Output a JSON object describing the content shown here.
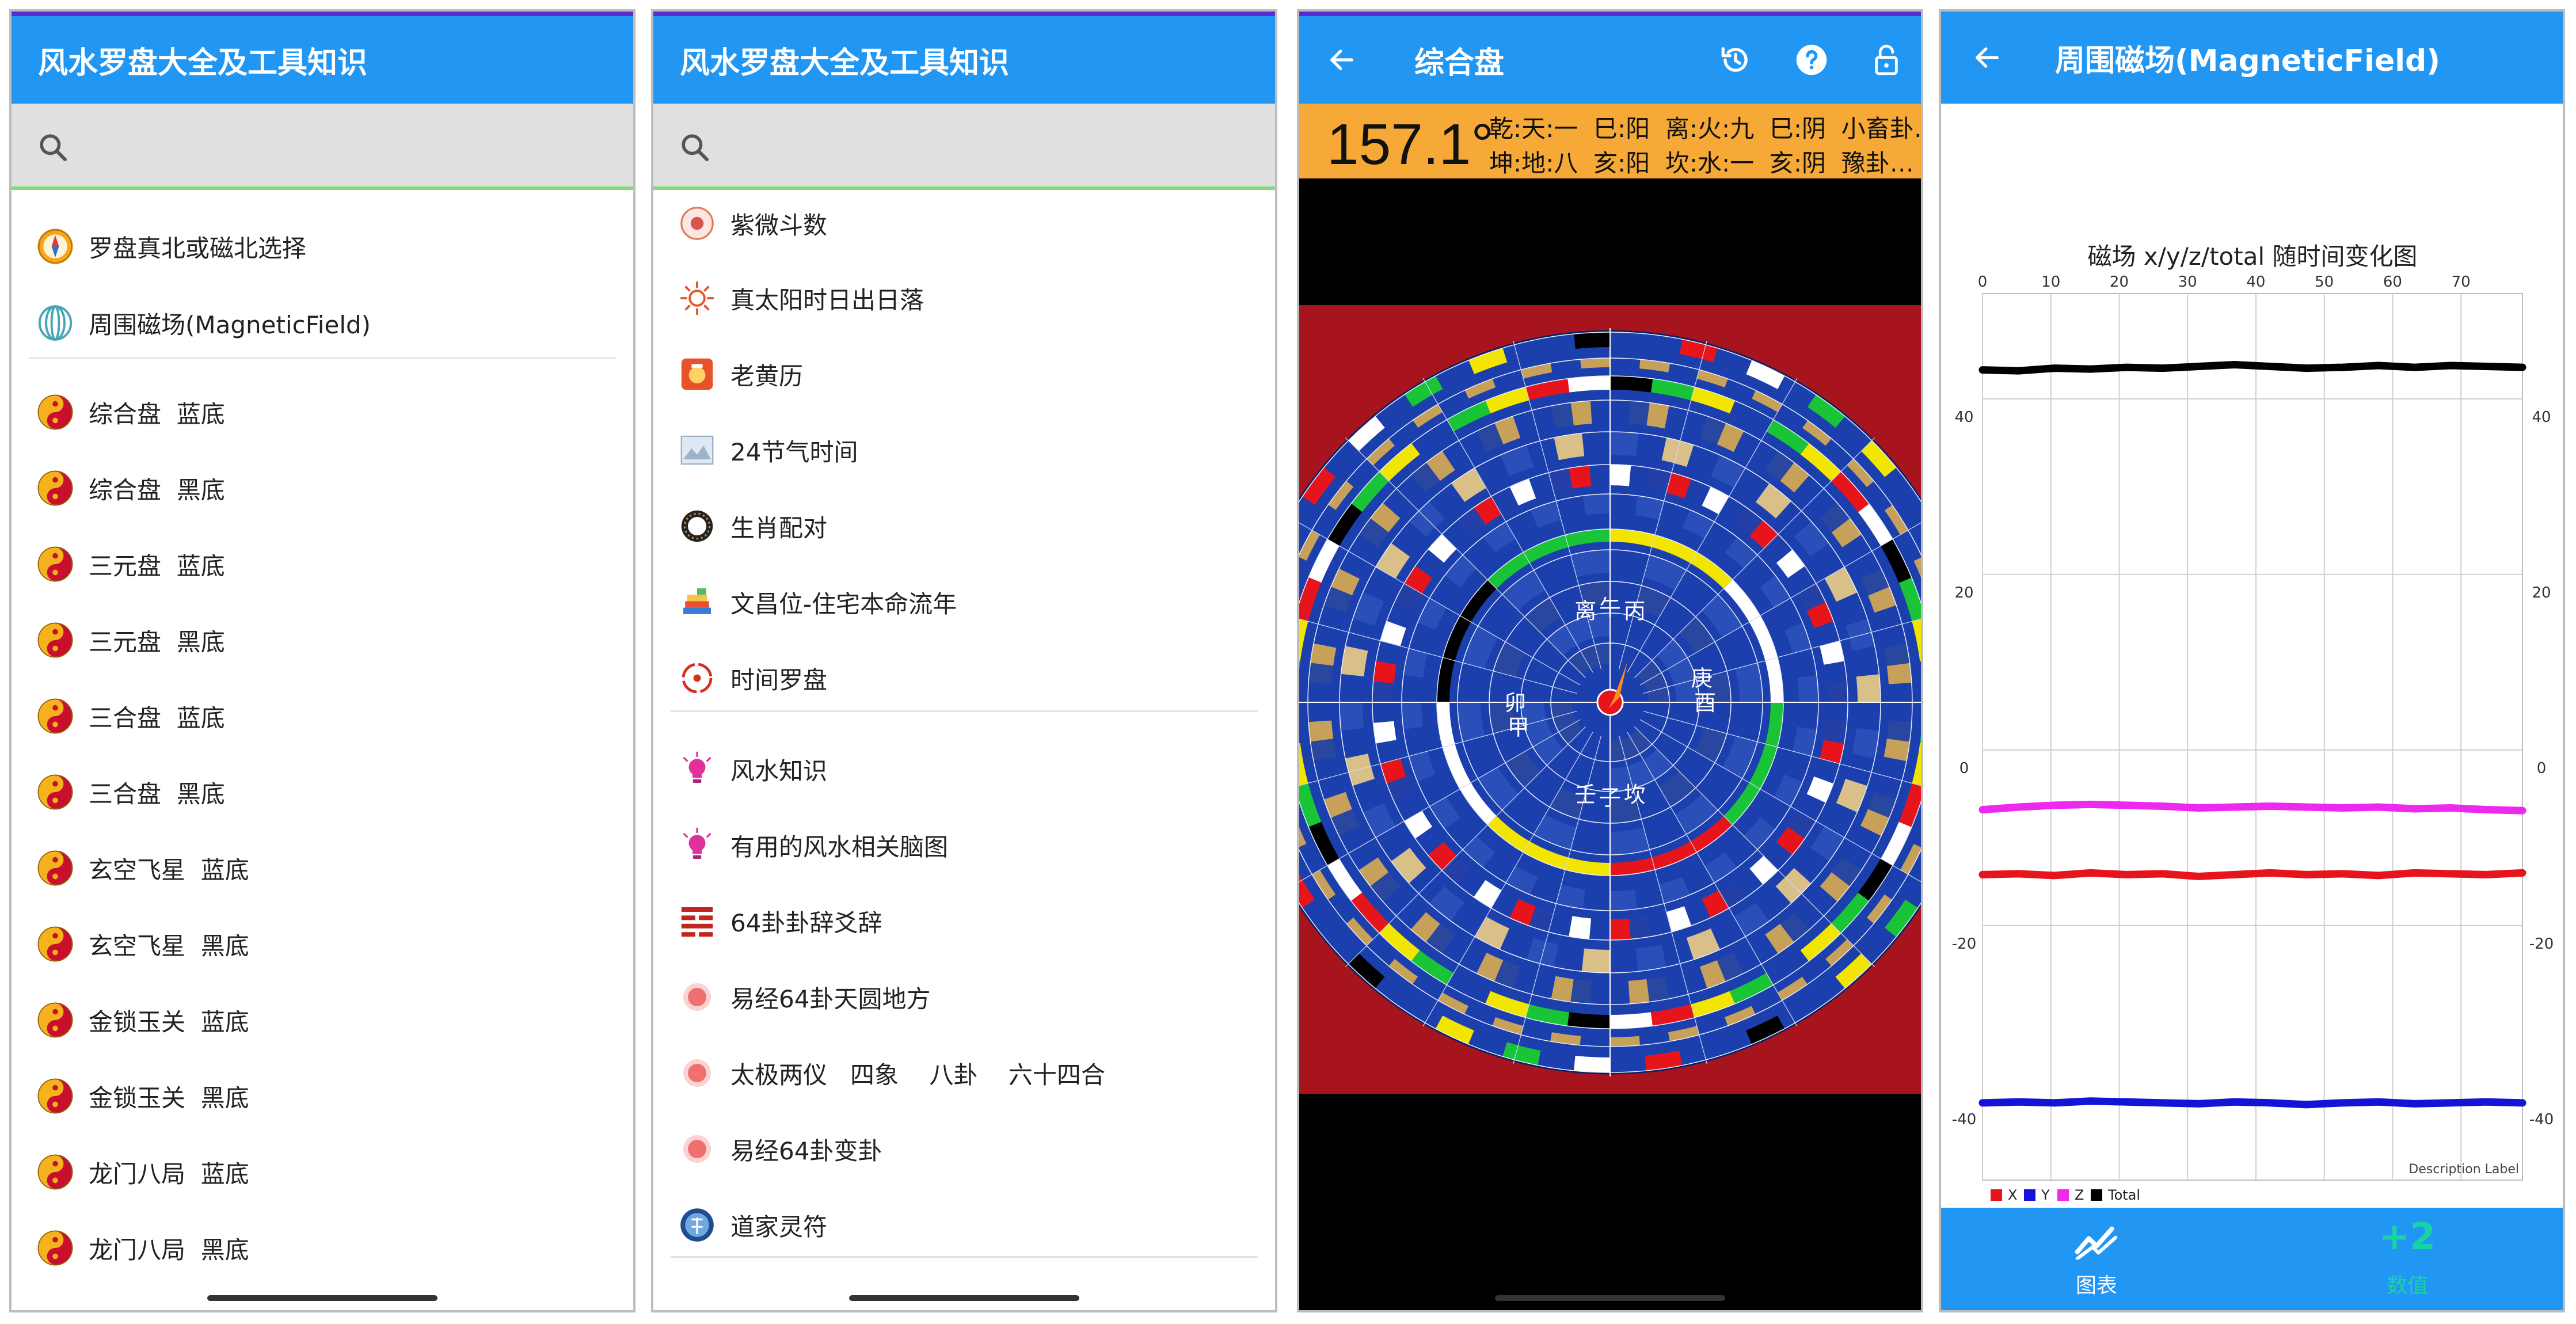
{
  "panel1": {
    "title": "风水罗盘大全及工具知识",
    "search_placeholder": "",
    "items": [
      {
        "label": "罗盘真北或磁北选择",
        "icon": "compass-icon"
      },
      {
        "label": "周围磁场(MagneticField)",
        "icon": "magnet-field-icon"
      },
      {
        "label": "综合盘  蓝底",
        "icon": "taiji-icon"
      },
      {
        "label": "综合盘  黑底",
        "icon": "taiji-icon"
      },
      {
        "label": "三元盘  蓝底",
        "icon": "taiji-icon"
      },
      {
        "label": "三元盘  黑底",
        "icon": "taiji-icon"
      },
      {
        "label": "三合盘  蓝底",
        "icon": "taiji-icon"
      },
      {
        "label": "三合盘  黑底",
        "icon": "taiji-icon"
      },
      {
        "label": "玄空飞星  蓝底",
        "icon": "taiji-icon"
      },
      {
        "label": "玄空飞星  黑底",
        "icon": "taiji-icon"
      },
      {
        "label": "金锁玉关  蓝底",
        "icon": "taiji-icon"
      },
      {
        "label": "金锁玉关  黑底",
        "icon": "taiji-icon"
      },
      {
        "label": "龙门八局  蓝底",
        "icon": "taiji-icon"
      },
      {
        "label": "龙门八局  黑底",
        "icon": "taiji-icon"
      }
    ]
  },
  "panel2": {
    "title": "风水罗盘大全及工具知识",
    "search_placeholder": "",
    "items": [
      {
        "label": "紫微斗数",
        "icon": "ziwei-icon"
      },
      {
        "label": "真太阳时日出日落",
        "icon": "sun-icon"
      },
      {
        "label": "老黄历",
        "icon": "almanac-icon"
      },
      {
        "label": "24节气时间",
        "icon": "solar-term-icon"
      },
      {
        "label": "生肖配对",
        "icon": "zodiac-ring-icon"
      },
      {
        "label": "文昌位-住宅本命流年",
        "icon": "books-icon"
      },
      {
        "label": "时间罗盘",
        "icon": "time-compass-icon"
      },
      {
        "label": "风水知识",
        "icon": "lightbulb-icon"
      },
      {
        "label": "有用的风水相关脑图",
        "icon": "lightbulb-icon"
      },
      {
        "label": "64卦卦辞爻辞",
        "icon": "hexagram-icon"
      },
      {
        "label": "易经64卦天圆地方",
        "icon": "red-dot-icon"
      },
      {
        "label": "太极两仪   四象    八卦    六十四合",
        "icon": "red-dot-icon"
      },
      {
        "label": "易经64卦变卦",
        "icon": "red-dot-icon"
      },
      {
        "label": "道家灵符",
        "icon": "taoist-charm-icon"
      }
    ]
  },
  "panel3": {
    "title": "综合盘",
    "degree": "157.1°",
    "trigram_line1": "乾:天:一  巳:阳  离:火:九  巳:阴  小畜卦…",
    "trigram_line2": "坤:地:八  亥:阳  坎:水:一  亥:阴  豫卦…",
    "compass_labels": [
      "子",
      "午",
      "卯",
      "酉",
      "壬",
      "丙",
      "甲",
      "庚",
      "坎",
      "离"
    ]
  },
  "panel4": {
    "title": "周围磁场(MagneticField)",
    "nav": [
      {
        "label": "图表",
        "icon": "line-chart-icon"
      },
      {
        "label": "数值",
        "badge": "+2"
      }
    ],
    "colors": {
      "X": "#e8141b",
      "Y": "#1414d8",
      "Z": "#ee28ee",
      "Total": "#000000"
    }
  },
  "chart_data": {
    "type": "line",
    "title": "磁场 x/y/z/total 随时间变化图",
    "description_label": "Description Label",
    "x_ticks": [
      "0",
      "10",
      "20",
      "30",
      "40",
      "50",
      "60",
      "70"
    ],
    "y_ticks": [
      "40",
      "20",
      "0",
      "-20",
      "-40"
    ],
    "xlim": [
      0,
      79
    ],
    "ylim": [
      -49,
      52
    ],
    "series": [
      {
        "name": "X",
        "color": "#e8141b",
        "values": [
          -14.2,
          -14.1,
          -14.3,
          -14.0,
          -14.2,
          -14.1,
          -14.4,
          -14.2,
          -14.0,
          -14.2,
          -14.1,
          -14.3,
          -14.0,
          -14.1,
          -14.2,
          -14.0
        ]
      },
      {
        "name": "Y",
        "color": "#1414d8",
        "values": [
          -40.2,
          -40.1,
          -40.2,
          -40.0,
          -40.1,
          -40.2,
          -40.3,
          -40.1,
          -40.2,
          -40.4,
          -40.2,
          -40.1,
          -40.3,
          -40.2,
          -40.1,
          -40.2
        ]
      },
      {
        "name": "Z",
        "color": "#ee28ee",
        "values": [
          -6.8,
          -6.5,
          -6.3,
          -6.2,
          -6.3,
          -6.4,
          -6.6,
          -6.5,
          -6.4,
          -6.5,
          -6.6,
          -6.5,
          -6.7,
          -6.6,
          -6.8,
          -6.9
        ]
      },
      {
        "name": "Total",
        "color": "#000000",
        "values": [
          43.3,
          43.2,
          43.5,
          43.4,
          43.6,
          43.5,
          43.7,
          43.9,
          43.7,
          43.5,
          43.6,
          43.8,
          43.6,
          43.8,
          43.7,
          43.6
        ]
      }
    ],
    "legend": "bottom-left"
  }
}
